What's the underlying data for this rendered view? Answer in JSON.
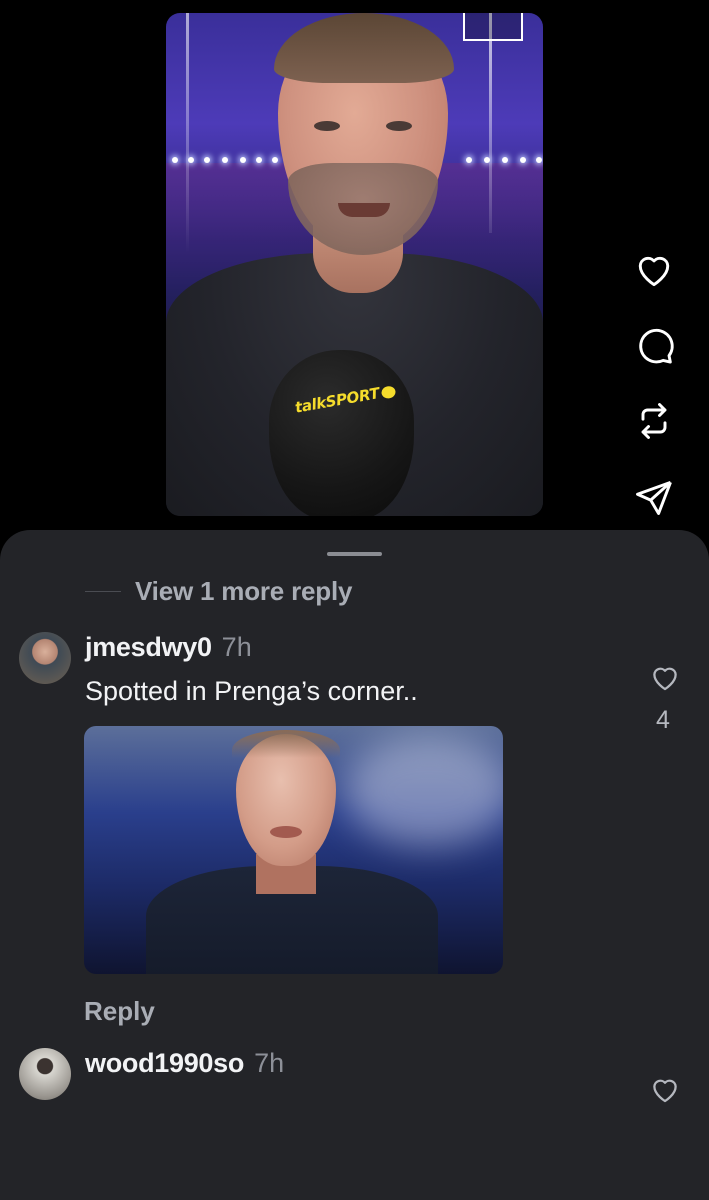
{
  "video": {
    "mic_logo": "talkSPORT",
    "corner_badge_text": ""
  },
  "actions": {
    "like_icon": "heart-outline-icon",
    "comment_icon": "comment-bubble-icon",
    "repost_icon": "repost-icon",
    "share_icon": "send-icon"
  },
  "sheet": {
    "more_replies": "View 1 more reply",
    "comments": [
      {
        "username": "jmesdwy0",
        "time": "7h",
        "text": "Spotted in Prenga’s corner..",
        "likes": "4",
        "reply_label": "Reply"
      },
      {
        "username": "wood1990so",
        "time": "7h"
      }
    ]
  }
}
